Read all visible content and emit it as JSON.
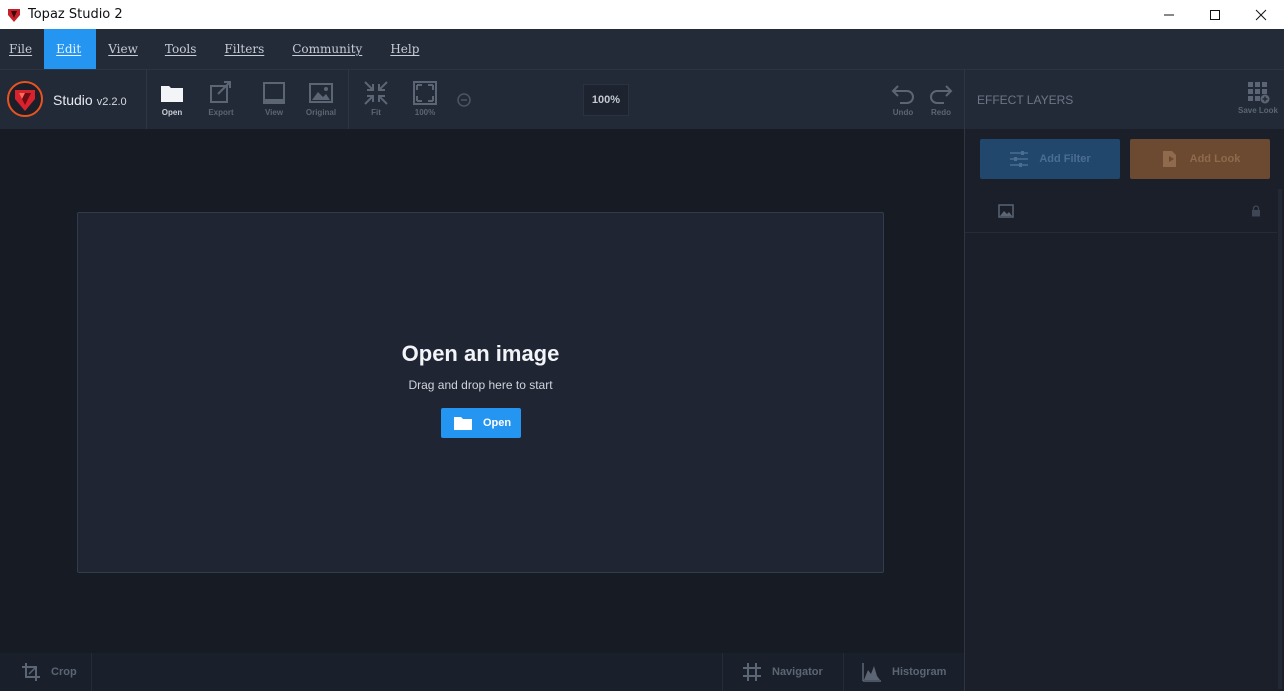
{
  "window": {
    "title": "Topaz Studio 2"
  },
  "menu": {
    "items": [
      {
        "label": "File",
        "active": false
      },
      {
        "label": "Edit",
        "active": true
      },
      {
        "label": "View",
        "active": false
      },
      {
        "label": "Tools",
        "active": false
      },
      {
        "label": "Filters",
        "active": false
      },
      {
        "label": "Community",
        "active": false
      },
      {
        "label": "Help",
        "active": false
      }
    ]
  },
  "toolbar": {
    "brand": "Studio",
    "version": "v2.2.0",
    "open_label": "Open",
    "export_label": "Export",
    "view_label": "View",
    "original_label": "Original",
    "fit_label": "Fit",
    "actual_label": "100%",
    "zoom_value": "100%",
    "undo_label": "Undo",
    "redo_label": "Redo"
  },
  "panel": {
    "title": "EFFECT LAYERS",
    "save_look_label": "Save Look",
    "add_filter_label": "Add Filter",
    "add_look_label": "Add Look"
  },
  "dropzone": {
    "title": "Open an image",
    "subtitle": "Drag and drop here to start",
    "button_label": "Open"
  },
  "bottombar": {
    "crop_label": "Crop",
    "navigator_label": "Navigator",
    "histogram_label": "Histogram"
  },
  "colors": {
    "accent": "#2496f2",
    "background": "#161b24",
    "panel": "#232a37",
    "add_filter": "#21476d",
    "add_look": "#6b4a31"
  }
}
